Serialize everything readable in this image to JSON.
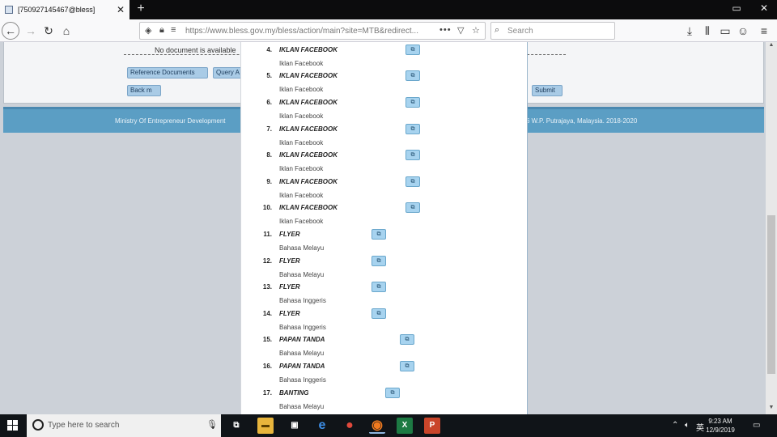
{
  "browser": {
    "tab_title": "[750927145467@bless]",
    "tab_close": "✕",
    "new_tab": "+",
    "url": "https://www.bless.gov.my/bless/action/main?site=MTB&redirect...",
    "url_more": "•••",
    "search_placeholder": "Search",
    "window_minimize": "▭",
    "window_close": "✕"
  },
  "page": {
    "no_document_text": "No document is available",
    "buttons": {
      "reference_documents": "Reference Documents",
      "query": "Query A",
      "back": "Back m",
      "submit": "Submit"
    },
    "footer_left": "Ministry Of Entrepreneur Development",
    "footer_right": "6 W.P. Putrajaya, Malaysia. 2018-2020"
  },
  "modal": {
    "items": [
      {
        "num": "4.",
        "title": "IKLAN FACEBOOK",
        "subtitle": "Iklan Facebook",
        "btn": "⧉"
      },
      {
        "num": "5.",
        "title": "IKLAN FACEBOOK",
        "subtitle": "Iklan Facebook",
        "btn": "⧉"
      },
      {
        "num": "6.",
        "title": "IKLAN FACEBOOK",
        "subtitle": "Iklan Facebook",
        "btn": "⧉"
      },
      {
        "num": "7.",
        "title": "IKLAN FACEBOOK",
        "subtitle": "Iklan Facebook",
        "btn": "⧉"
      },
      {
        "num": "8.",
        "title": "IKLAN FACEBOOK",
        "subtitle": "Iklan Facebook",
        "btn": "⧉"
      },
      {
        "num": "9.",
        "title": "IKLAN FACEBOOK",
        "subtitle": "Iklan Facebook",
        "btn": "⧉"
      },
      {
        "num": "10.",
        "title": "IKLAN FACEBOOK",
        "subtitle": "Iklan Facebook",
        "btn": "⧉"
      },
      {
        "num": "11.",
        "title": "FLYER",
        "subtitle": "Bahasa Melayu",
        "btn": "⧉"
      },
      {
        "num": "12.",
        "title": "FLYER",
        "subtitle": "Bahasa Melayu",
        "btn": "⧉"
      },
      {
        "num": "13.",
        "title": "FLYER",
        "subtitle": "Bahasa Inggeris",
        "btn": "⧉"
      },
      {
        "num": "14.",
        "title": "FLYER",
        "subtitle": "Bahasa Inggeris",
        "btn": "⧉"
      },
      {
        "num": "15.",
        "title": "PAPAN TANDA",
        "subtitle": "Bahasa Melayu",
        "btn": "⧉"
      },
      {
        "num": "16.",
        "title": "PAPAN TANDA",
        "subtitle": "Bahasa Inggeris",
        "btn": "⧉"
      },
      {
        "num": "17.",
        "title": "BANTING",
        "subtitle": "Bahasa Melayu",
        "btn": "⧉"
      }
    ]
  },
  "taskbar": {
    "search_placeholder": "Type here to search",
    "time": "9:23 AM",
    "date": "12/9/2019",
    "apps": [
      {
        "name": "task-view",
        "glyph": "⧉",
        "color": "#101418"
      },
      {
        "name": "file-explorer",
        "glyph": "▬",
        "color": "#e8b53c"
      },
      {
        "name": "store",
        "glyph": "▣",
        "color": "#101418"
      },
      {
        "name": "edge",
        "glyph": "e",
        "color": "#1e78d4"
      },
      {
        "name": "chrome",
        "glyph": "●",
        "color": "#d9453c"
      },
      {
        "name": "firefox",
        "glyph": "◉",
        "color": "#e66b1f"
      },
      {
        "name": "excel",
        "glyph": "X",
        "color": "#1d7a43"
      },
      {
        "name": "powerpoint",
        "glyph": "P",
        "color": "#c9452a"
      }
    ]
  }
}
